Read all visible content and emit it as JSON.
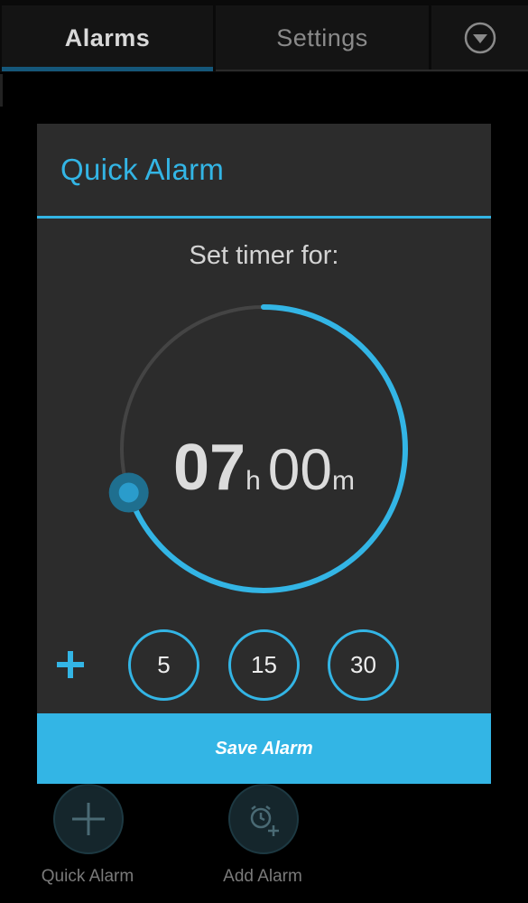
{
  "tabs": {
    "alarms": "Alarms",
    "settings": "Settings",
    "menu_icon": "dropdown-circle-icon"
  },
  "dialog": {
    "title": "Quick Alarm",
    "subtitle": "Set timer for:",
    "time": {
      "hours": "07",
      "hours_unit": "h",
      "minutes": "00",
      "minutes_unit": "m"
    },
    "dial_progress": 0.7,
    "add_icon": "plus-icon",
    "quick_buttons": [
      "5",
      "15",
      "30"
    ],
    "save_label": "Save Alarm"
  },
  "bottom_actions": {
    "quick_alarm": {
      "label": "Quick Alarm",
      "icon": "plus-icon"
    },
    "add_alarm": {
      "label": "Add Alarm",
      "icon": "alarm-clock-add-icon"
    }
  },
  "colors": {
    "accent": "#33b5e5",
    "dialog_bg": "#2c2c2c",
    "track": "#444444",
    "knob": "#1f6f8f"
  }
}
